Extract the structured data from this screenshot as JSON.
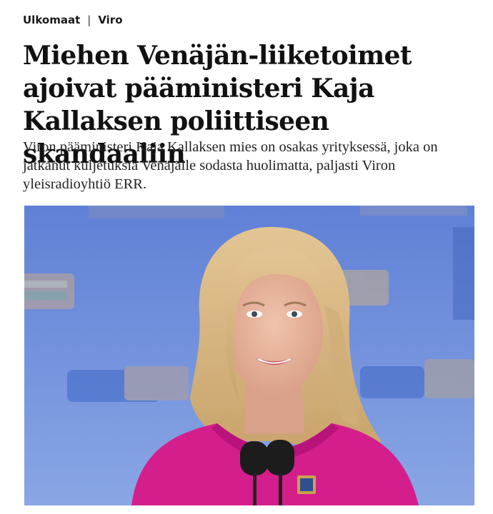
{
  "breadcrumb": {
    "section": "Ulkomaat",
    "separator": "|",
    "topic": "Viro"
  },
  "article": {
    "headline": "Miehen Venäjän-liiketoimet ajoivat pääministeri Kaja Kallaksen poliittiseen skandaaliin",
    "lead": "Viron pääministeri Kaja Kallaksen mies on osakas yrityksessä, joka on jatkanut kuljetuksia Venäjälle sodasta huolimatta, paljasti Viron yleisradioyhtiö ERR."
  },
  "photo": {
    "background_color": "#6f8ed8",
    "top_color": "#5f80d6",
    "bottom_color": "#8aa6e4",
    "jacket_color": "#d41e8c",
    "hair_color": "#d9b987",
    "skin_color": "#e7b39c"
  }
}
